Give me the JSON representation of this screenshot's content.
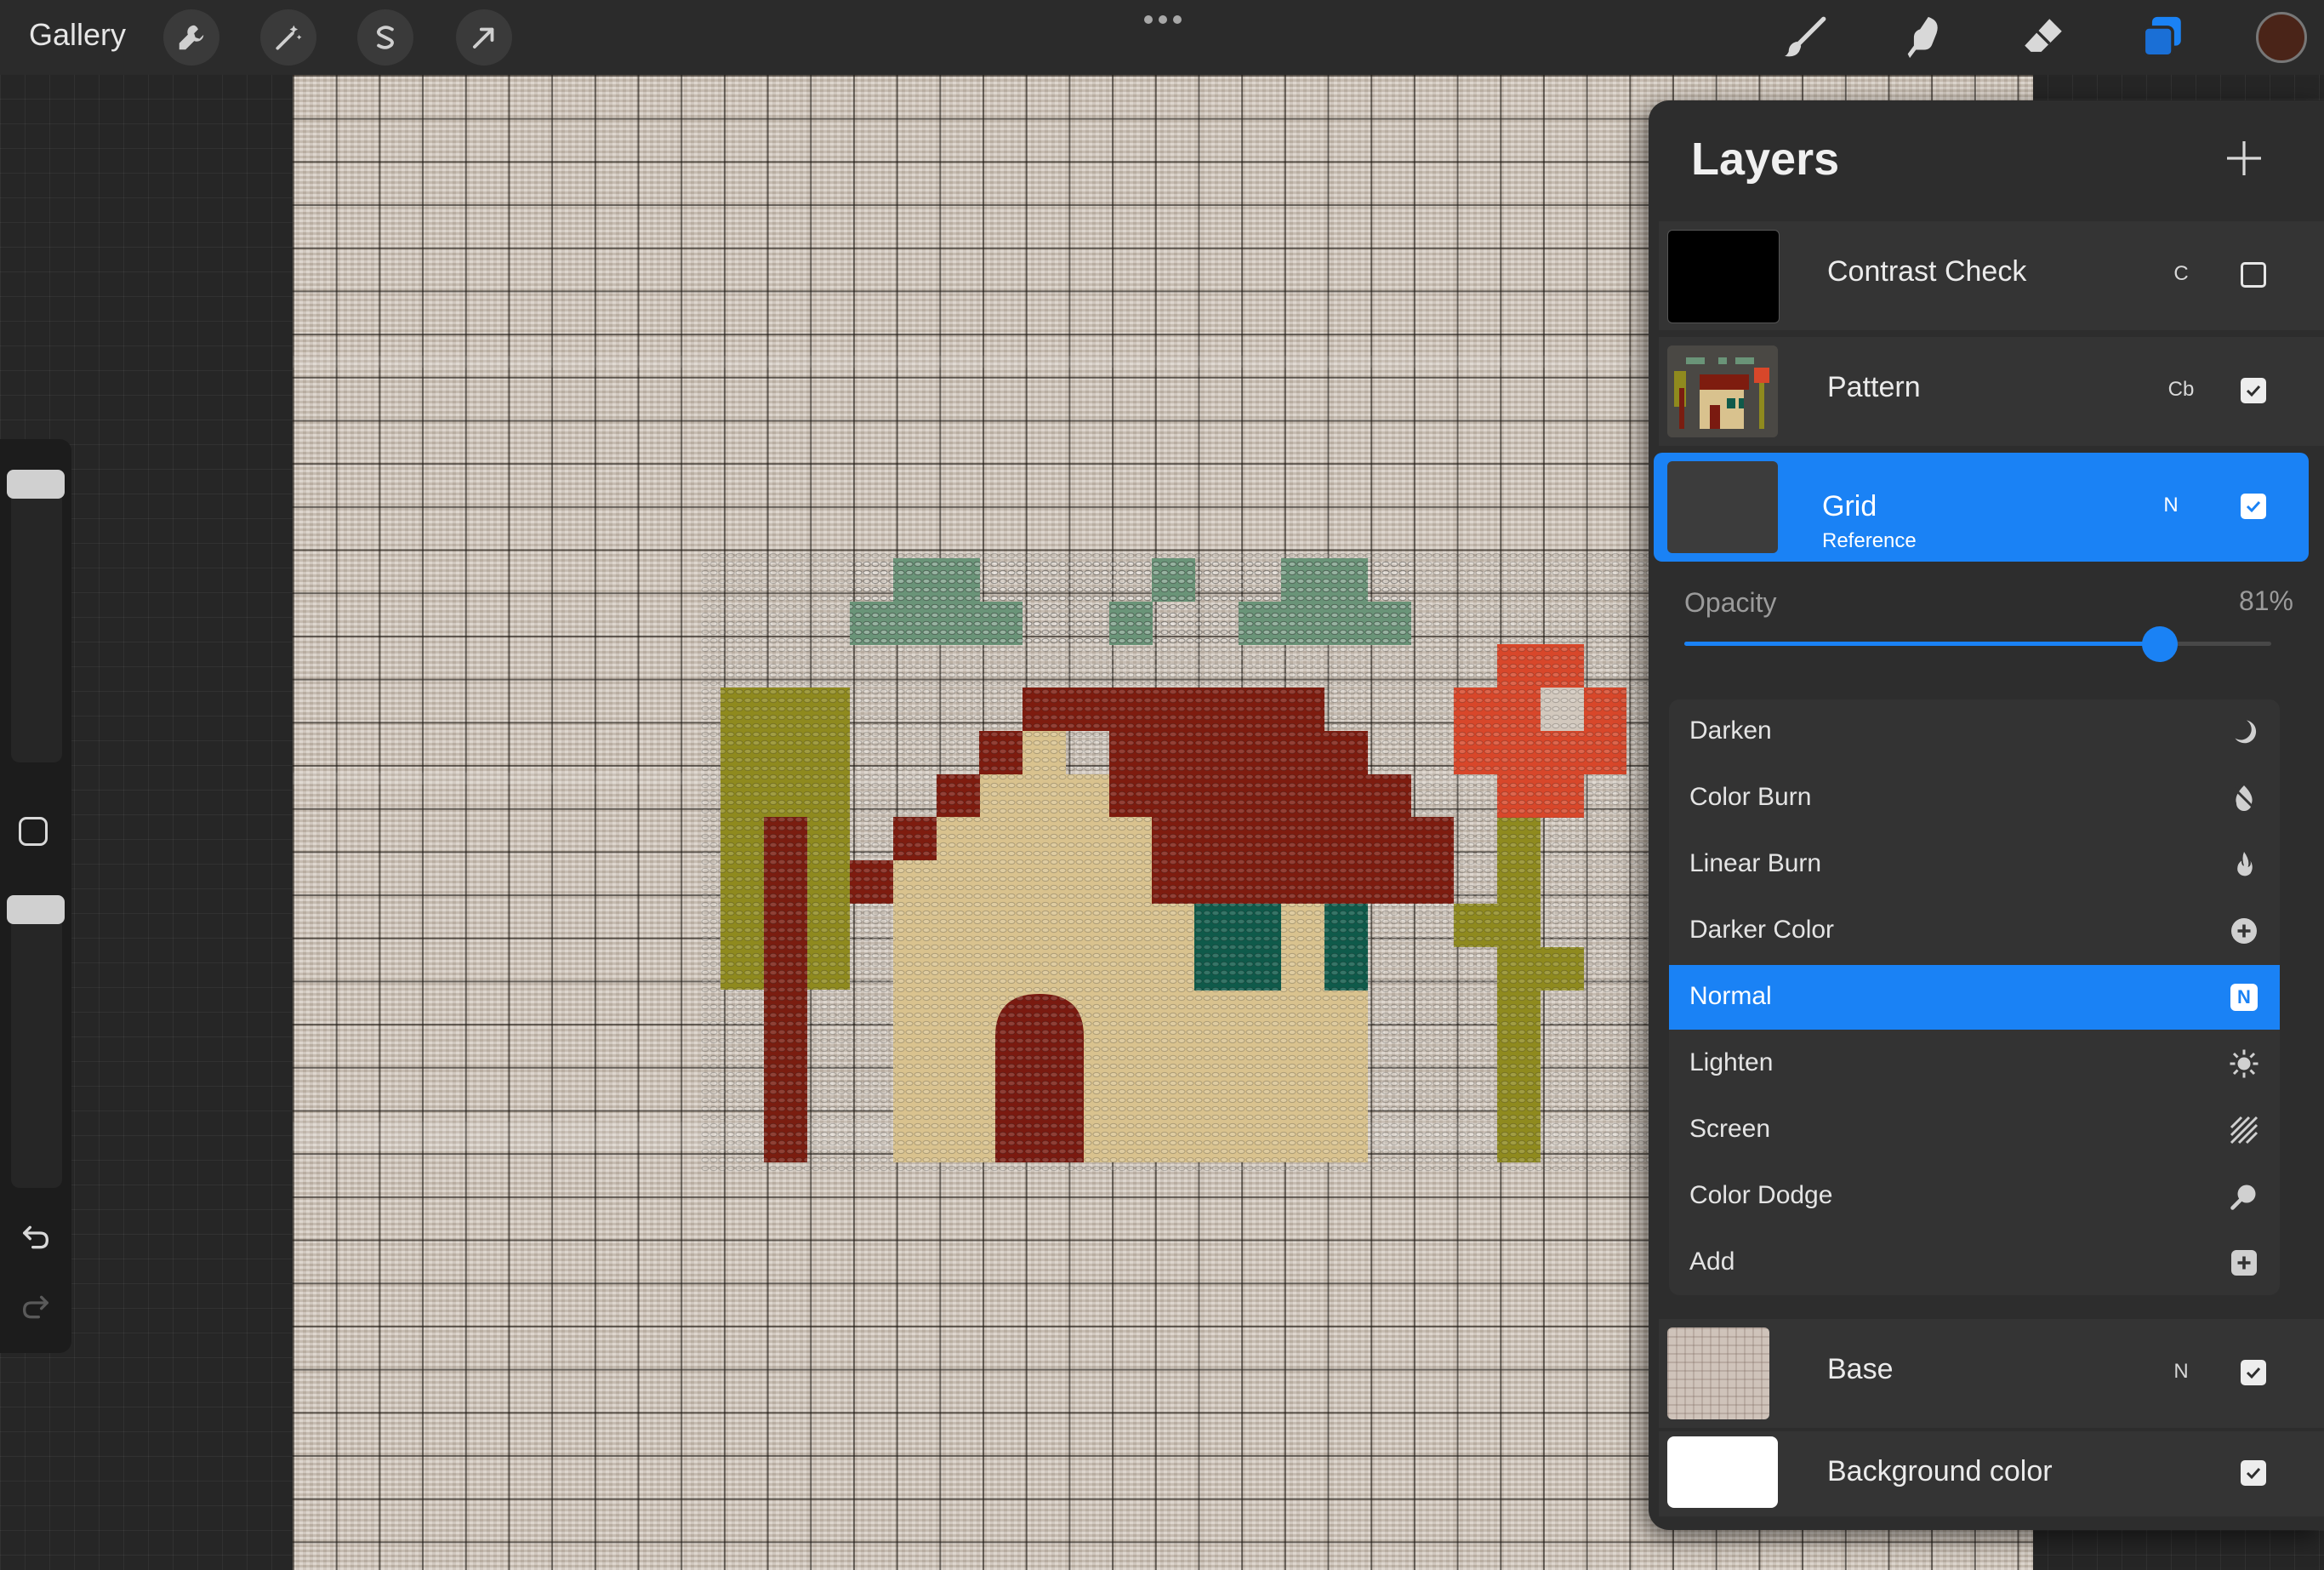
{
  "app": {
    "gallery_label": "Gallery",
    "toolbar_left": [
      {
        "name": "actions-wrench-icon"
      },
      {
        "name": "adjustments-wand-icon"
      },
      {
        "name": "selection-s-icon"
      },
      {
        "name": "transform-arrow-icon"
      }
    ],
    "toolbar_right": [
      {
        "name": "brush-icon"
      },
      {
        "name": "smudge-icon"
      },
      {
        "name": "eraser-icon"
      },
      {
        "name": "layers-icon"
      }
    ],
    "current_color": "#4a2418",
    "accent_color": "#1a82f5"
  },
  "sidebar": {
    "brush_size": 0.95,
    "brush_opacity": 0.95
  },
  "layers_panel": {
    "title": "Layers",
    "layers_top": [
      {
        "name": "Contrast Check",
        "blend": "C",
        "visible": false,
        "thumb": "black"
      },
      {
        "name": "Pattern",
        "blend": "Cb",
        "visible": true,
        "thumb": "pattern"
      },
      {
        "name": "Grid",
        "subtitle": "Reference",
        "blend": "N",
        "visible": true,
        "thumb": "grid",
        "selected": true
      }
    ],
    "opacity_label": "Opacity",
    "opacity_value": "81%",
    "opacity_fraction": 0.81,
    "blend_modes": [
      {
        "name": "Darken",
        "icon": "moon-icon"
      },
      {
        "name": "Color Burn",
        "icon": "burn-icon"
      },
      {
        "name": "Linear Burn",
        "icon": "flame-icon"
      },
      {
        "name": "Darker Color",
        "icon": "plus-circle-icon"
      },
      {
        "name": "Normal",
        "icon": "n-badge-icon",
        "active": true
      },
      {
        "name": "Lighten",
        "icon": "sun-icon"
      },
      {
        "name": "Screen",
        "icon": "hatch-icon"
      },
      {
        "name": "Color Dodge",
        "icon": "dodge-icon"
      },
      {
        "name": "Add",
        "icon": "plus-square-icon"
      }
    ],
    "normal_badge": "N",
    "layers_bottom": [
      {
        "name": "Base",
        "blend": "N",
        "visible": true,
        "thumb": "fabric"
      },
      {
        "name": "Background color",
        "blend": "",
        "visible": true,
        "thumb": "white"
      }
    ]
  }
}
